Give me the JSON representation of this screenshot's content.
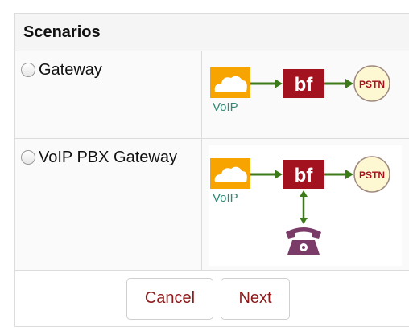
{
  "panel": {
    "title": "Scenarios"
  },
  "scenarios": [
    {
      "label": "Gateway",
      "selected": false,
      "diagram": {
        "voip_label": "VoIP",
        "device_label": "bf",
        "pstn_label": "PSTN"
      }
    },
    {
      "label": "VoIP PBX Gateway",
      "selected": false,
      "diagram": {
        "voip_label": "VoIP",
        "device_label": "bf",
        "pstn_label": "PSTN",
        "phone_icon": "telephone-icon"
      }
    }
  ],
  "footer": {
    "cancel_label": "Cancel",
    "next_label": "Next"
  },
  "colors": {
    "device_red": "#a3121f",
    "arrow_green": "#3d7a19",
    "voip_label": "#2d8a73",
    "cloud_orange": "#f7a400",
    "pstn_fill": "#fdf8d2",
    "button_text": "#8e1b1b",
    "phone_purple": "#7a3b69"
  }
}
